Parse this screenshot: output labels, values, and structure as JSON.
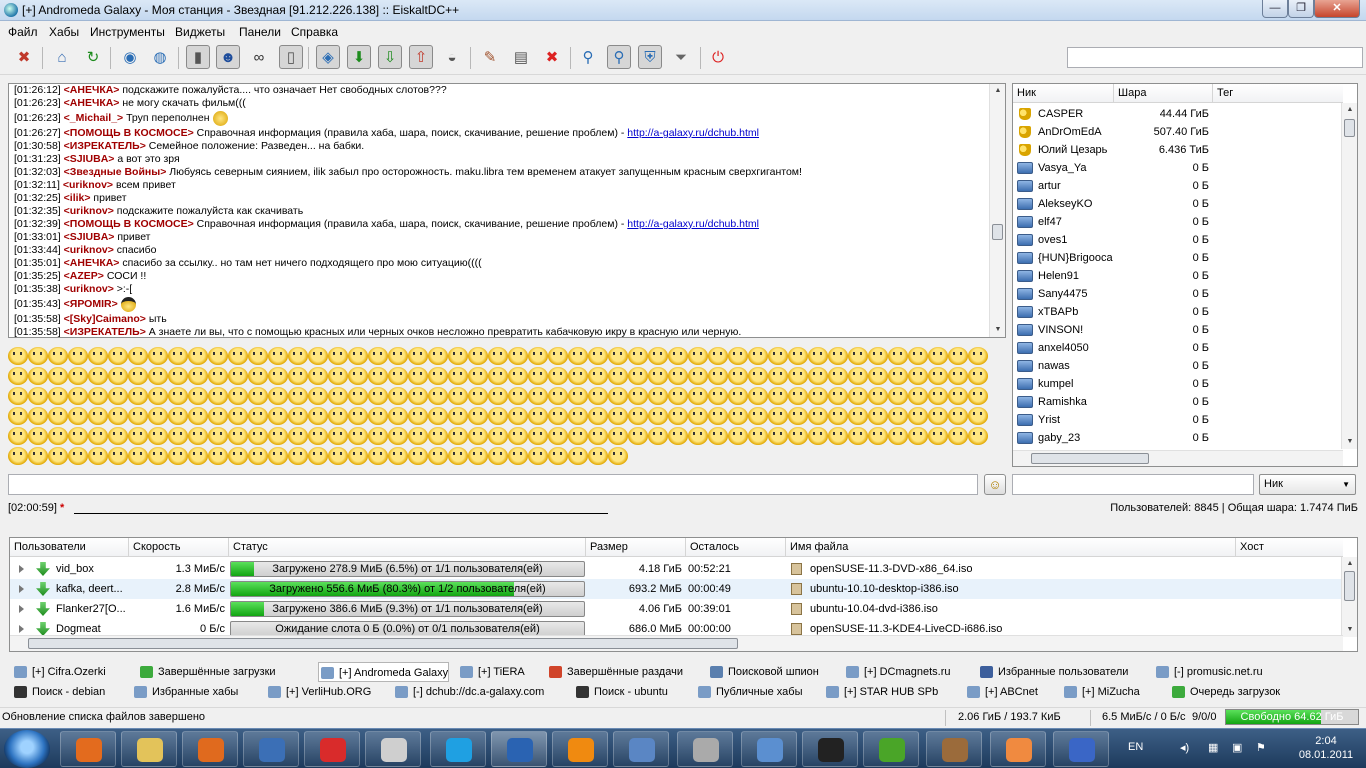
{
  "window": {
    "title": "[+] Andromeda Galaxy - Моя станция - Звездная [91.212.226.138] :: EiskaltDC++",
    "min_label": "—",
    "max_label": "❐",
    "close_label": "✕"
  },
  "menu": [
    "Файл",
    "Хабы",
    "Инструменты",
    "Виджеты",
    "Панели",
    "Справка"
  ],
  "chat": [
    {
      "time": "[01:26:12]",
      "nick": "<АНЕЧКА>",
      "text": " подскажите пожалуйста.... что означает Нет свободных слотов???"
    },
    {
      "time": "[01:26:23]",
      "nick": "<АНЕЧКА>",
      "text": " не могу скачать фильм((("
    },
    {
      "time": "[01:26:23]",
      "nick": "<_Michail_>",
      "text": " Труп переполнен"
    },
    {
      "time": "[01:26:27]",
      "nick": "<ПОМОЩЬ В КОСМОСЕ>",
      "text": " Справочная информация (правила хаба, шара, поиск, скачивание, решение проблем) - ",
      "link": "http://a-galaxy.ru/dchub.html"
    },
    {
      "time": "[01:30:58]",
      "nick": "<ИЗРЕКАТЕЛЬ>",
      "text": " Семейное положение: Разведен... на бабки."
    },
    {
      "time": "[01:31:23]",
      "nick": "<SJIUBA>",
      "text": " а вот это зря"
    },
    {
      "time": "[01:32:03]",
      "nick": "<Звездные Войны>",
      "text": " Любуясь северным сиянием, ilik забыл про осторожность. maku.libra тем временем атакует запущенным красным сверхгигантом!"
    },
    {
      "time": "[01:32:11]",
      "nick": "<uriknov>",
      "text": " всем привет"
    },
    {
      "time": "[01:32:25]",
      "nick": "<ilik>",
      "text": " привет"
    },
    {
      "time": "[01:32:35]",
      "nick": "<uriknov>",
      "text": " подскажите пожалуйста как скачивать"
    },
    {
      "time": "[01:32:39]",
      "nick": "<ПОМОЩЬ В КОСМОСЕ>",
      "text": " Справочная информация (правила хаба, шара, поиск, скачивание, решение проблем) - ",
      "link": "http://a-galaxy.ru/dchub.html"
    },
    {
      "time": "[01:33:01]",
      "nick": "<SJIUBA>",
      "text": " привет"
    },
    {
      "time": "[01:33:44]",
      "nick": "<uriknov>",
      "text": " спасибо"
    },
    {
      "time": "[01:35:01]",
      "nick": "<АНЕЧКА>",
      "text": " спасибо за ссылку.. но там нет ничего подходящего про мою ситуацию(((("
    },
    {
      "time": "[01:35:25]",
      "nick": "<AZEP>",
      "text": " СОСИ !!"
    },
    {
      "time": "[01:35:38]",
      "nick": "<uriknov>",
      "text": "  >:-["
    },
    {
      "time": "[01:35:43]",
      "nick": "<ЯРОМIR>",
      "text": ""
    },
    {
      "time": "[01:35:58]",
      "nick": "<[Sky]Caimano>",
      "text": " ыть"
    },
    {
      "time": "[01:35:58]",
      "nick": "<ИЗРЕКАТЕЛЬ>",
      "text": " А знаете ли вы, что с помощью красных или черных очков несложно превратить кабачковую икру в красную или черную."
    }
  ],
  "userlist": {
    "columns": [
      "Ник",
      "Шара",
      "Тег"
    ],
    "users": [
      {
        "nick": "CASPER",
        "share": "44.44 ГиБ",
        "icon": "key-icon"
      },
      {
        "nick": "AnDrOmEdA",
        "share": "507.40 ГиБ",
        "icon": "key-icon"
      },
      {
        "nick": "Юлий Цезарь",
        "share": "6.436 ТиБ",
        "icon": "key-icon"
      },
      {
        "nick": "Vasya_Ya",
        "share": "0 Б",
        "icon": "user-icon"
      },
      {
        "nick": "artur",
        "share": "0 Б",
        "icon": "user-icon"
      },
      {
        "nick": "AlekseyKO",
        "share": "0 Б",
        "icon": "user-icon"
      },
      {
        "nick": "elf47",
        "share": "0 Б",
        "icon": "user-icon"
      },
      {
        "nick": "oves1",
        "share": "0 Б",
        "icon": "user-icon"
      },
      {
        "nick": "{HUN}Brigooca",
        "share": "0 Б",
        "icon": "user-icon"
      },
      {
        "nick": "Helen91",
        "share": "0 Б",
        "icon": "user-icon"
      },
      {
        "nick": "Sany4475",
        "share": "0 Б",
        "icon": "user-icon"
      },
      {
        "nick": "xTBAPb",
        "share": "0 Б",
        "icon": "user-icon"
      },
      {
        "nick": "VINSON!",
        "share": "0 Б",
        "icon": "user-icon"
      },
      {
        "nick": "anxel4050",
        "share": "0 Б",
        "icon": "user-icon"
      },
      {
        "nick": "nawas",
        "share": "0 Б",
        "icon": "user-icon"
      },
      {
        "nick": "kumpel",
        "share": "0 Б",
        "icon": "user-icon"
      },
      {
        "nick": "Ramishka",
        "share": "0 Б",
        "icon": "user-icon"
      },
      {
        "nick": "Yrist",
        "share": "0 Б",
        "icon": "user-icon"
      },
      {
        "nick": "gaby_23",
        "share": "0 Б",
        "icon": "user-icon"
      }
    ]
  },
  "input": {
    "nick_select": "Ник"
  },
  "status": {
    "time": "[02:00:59]",
    "marker": "*",
    "users_stats": "Пользователей: 8845 | Общая шара: 1.7474 ПиБ"
  },
  "transfers": {
    "columns": [
      "Пользователи",
      "Скорость",
      "Статус",
      "Размер",
      "Осталось",
      "Имя файла",
      "Хост"
    ],
    "rows": [
      {
        "user": "vid_box",
        "speed": "1.3 МиБ/с",
        "status": "Загружено 278.9 МиБ (6.5%) от 1/1 пользователя(ей)",
        "progress": 0.065,
        "size": "4.18 ГиБ",
        "left": "00:52:21",
        "file": "openSUSE-11.3-DVD-x86_64.iso"
      },
      {
        "user": "kafka, deert...",
        "speed": "2.8 МиБ/с",
        "status": "Загружено 556.6 МиБ (80.3%) от 1/2 пользователя(ей)",
        "progress": 0.803,
        "size": "693.2 МиБ",
        "left": "00:00:49",
        "file": "ubuntu-10.10-desktop-i386.iso"
      },
      {
        "user": "Flanker27[O...",
        "speed": "1.6 МиБ/с",
        "status": "Загружено 386.6 МиБ (9.3%) от 1/1 пользователя(ей)",
        "progress": 0.093,
        "size": "4.06 ГиБ",
        "left": "00:39:01",
        "file": "ubuntu-10.04-dvd-i386.iso"
      },
      {
        "user": "Dogmeat",
        "speed": "0 Б/с",
        "status": "Ожидание слота 0 Б (0.0%) от 0/1 пользователя(ей)",
        "progress": 0.0,
        "size": "686.0 МиБ",
        "left": "00:00:00",
        "file": "openSUSE-11.3-KDE4-LiveCD-i686.iso"
      }
    ]
  },
  "tabs": [
    {
      "label": "[+] Cifra.Ozerki",
      "color": "#7a9cc6"
    },
    {
      "label": "Завершённые загрузки",
      "color": "#3caa3c"
    },
    {
      "label": "[+] Andromeda Galaxy",
      "color": "#7a9cc6"
    },
    {
      "label": "[+] TiERA",
      "color": "#7a9cc6"
    },
    {
      "label": "Завершённые раздачи",
      "color": "#d0442a"
    },
    {
      "label": "Поисковой шпион",
      "color": "#5a7fae"
    },
    {
      "label": "[+] DCmagnets.ru",
      "color": "#7a9cc6"
    },
    {
      "label": "Избранные пользователи",
      "color": "#3d5f9c"
    },
    {
      "label": "[-] promusic.net.ru",
      "color": "#7a9cc6"
    },
    {
      "label": "Поиск - debian",
      "color": "#333333"
    },
    {
      "label": "Избранные хабы",
      "color": "#7a9cc6"
    },
    {
      "label": "[+] VerliHub.ORG",
      "color": "#7a9cc6"
    },
    {
      "label": "[-] dchub://dc.a-galaxy.com",
      "color": "#7a9cc6"
    },
    {
      "label": "Поиск - ubuntu",
      "color": "#333333"
    },
    {
      "label": "Публичные хабы",
      "color": "#7a9cc6"
    },
    {
      "label": "[+] STAR HUB SPb",
      "color": "#7a9cc6"
    },
    {
      "label": "[+] ABCnet",
      "color": "#7a9cc6"
    },
    {
      "label": "[+] MiZucha",
      "color": "#7a9cc6"
    },
    {
      "label": "Очередь загрузок",
      "color": "#3caa3c"
    }
  ],
  "statusbar": {
    "message": "Обновление списка файлов завершено",
    "shared": "2.06 ГиБ / 193.7 КиБ",
    "speed": "6.5 МиБ/с / 0 Б/с",
    "slots": "9/0/0",
    "free": "Свободно 64.62 ГиБ",
    "free_fraction": 0.72
  },
  "taskbar": {
    "lang": "EN",
    "time": "2:04",
    "date": "08.01.2011",
    "apps": [
      {
        "name": "firefox",
        "color": "#e36b1e"
      },
      {
        "name": "explorer",
        "color": "#e3c35a"
      },
      {
        "name": "media-player",
        "color": "#e06a1e"
      },
      {
        "name": "pidgin",
        "color": "#3b6fb6"
      },
      {
        "name": "pin",
        "color": "#d92b2b"
      },
      {
        "name": "clock",
        "color": "#cfcfcf"
      },
      {
        "name": "skype",
        "color": "#1fa0e2"
      },
      {
        "name": "eiskaltdc",
        "color": "#2a63b2"
      },
      {
        "name": "vlc",
        "color": "#f08a10"
      },
      {
        "name": "virtualbox",
        "color": "#5a86c4"
      },
      {
        "name": "tools",
        "color": "#aaaaaa"
      },
      {
        "name": "thunderbird",
        "color": "#5b8fd0"
      },
      {
        "name": "7zip",
        "color": "#222222"
      },
      {
        "name": "utorrent",
        "color": "#4aa528"
      },
      {
        "name": "reader",
        "color": "#9b6b3b"
      },
      {
        "name": "app-orange",
        "color": "#f08a40"
      },
      {
        "name": "plus",
        "color": "#3a66c6"
      }
    ]
  }
}
